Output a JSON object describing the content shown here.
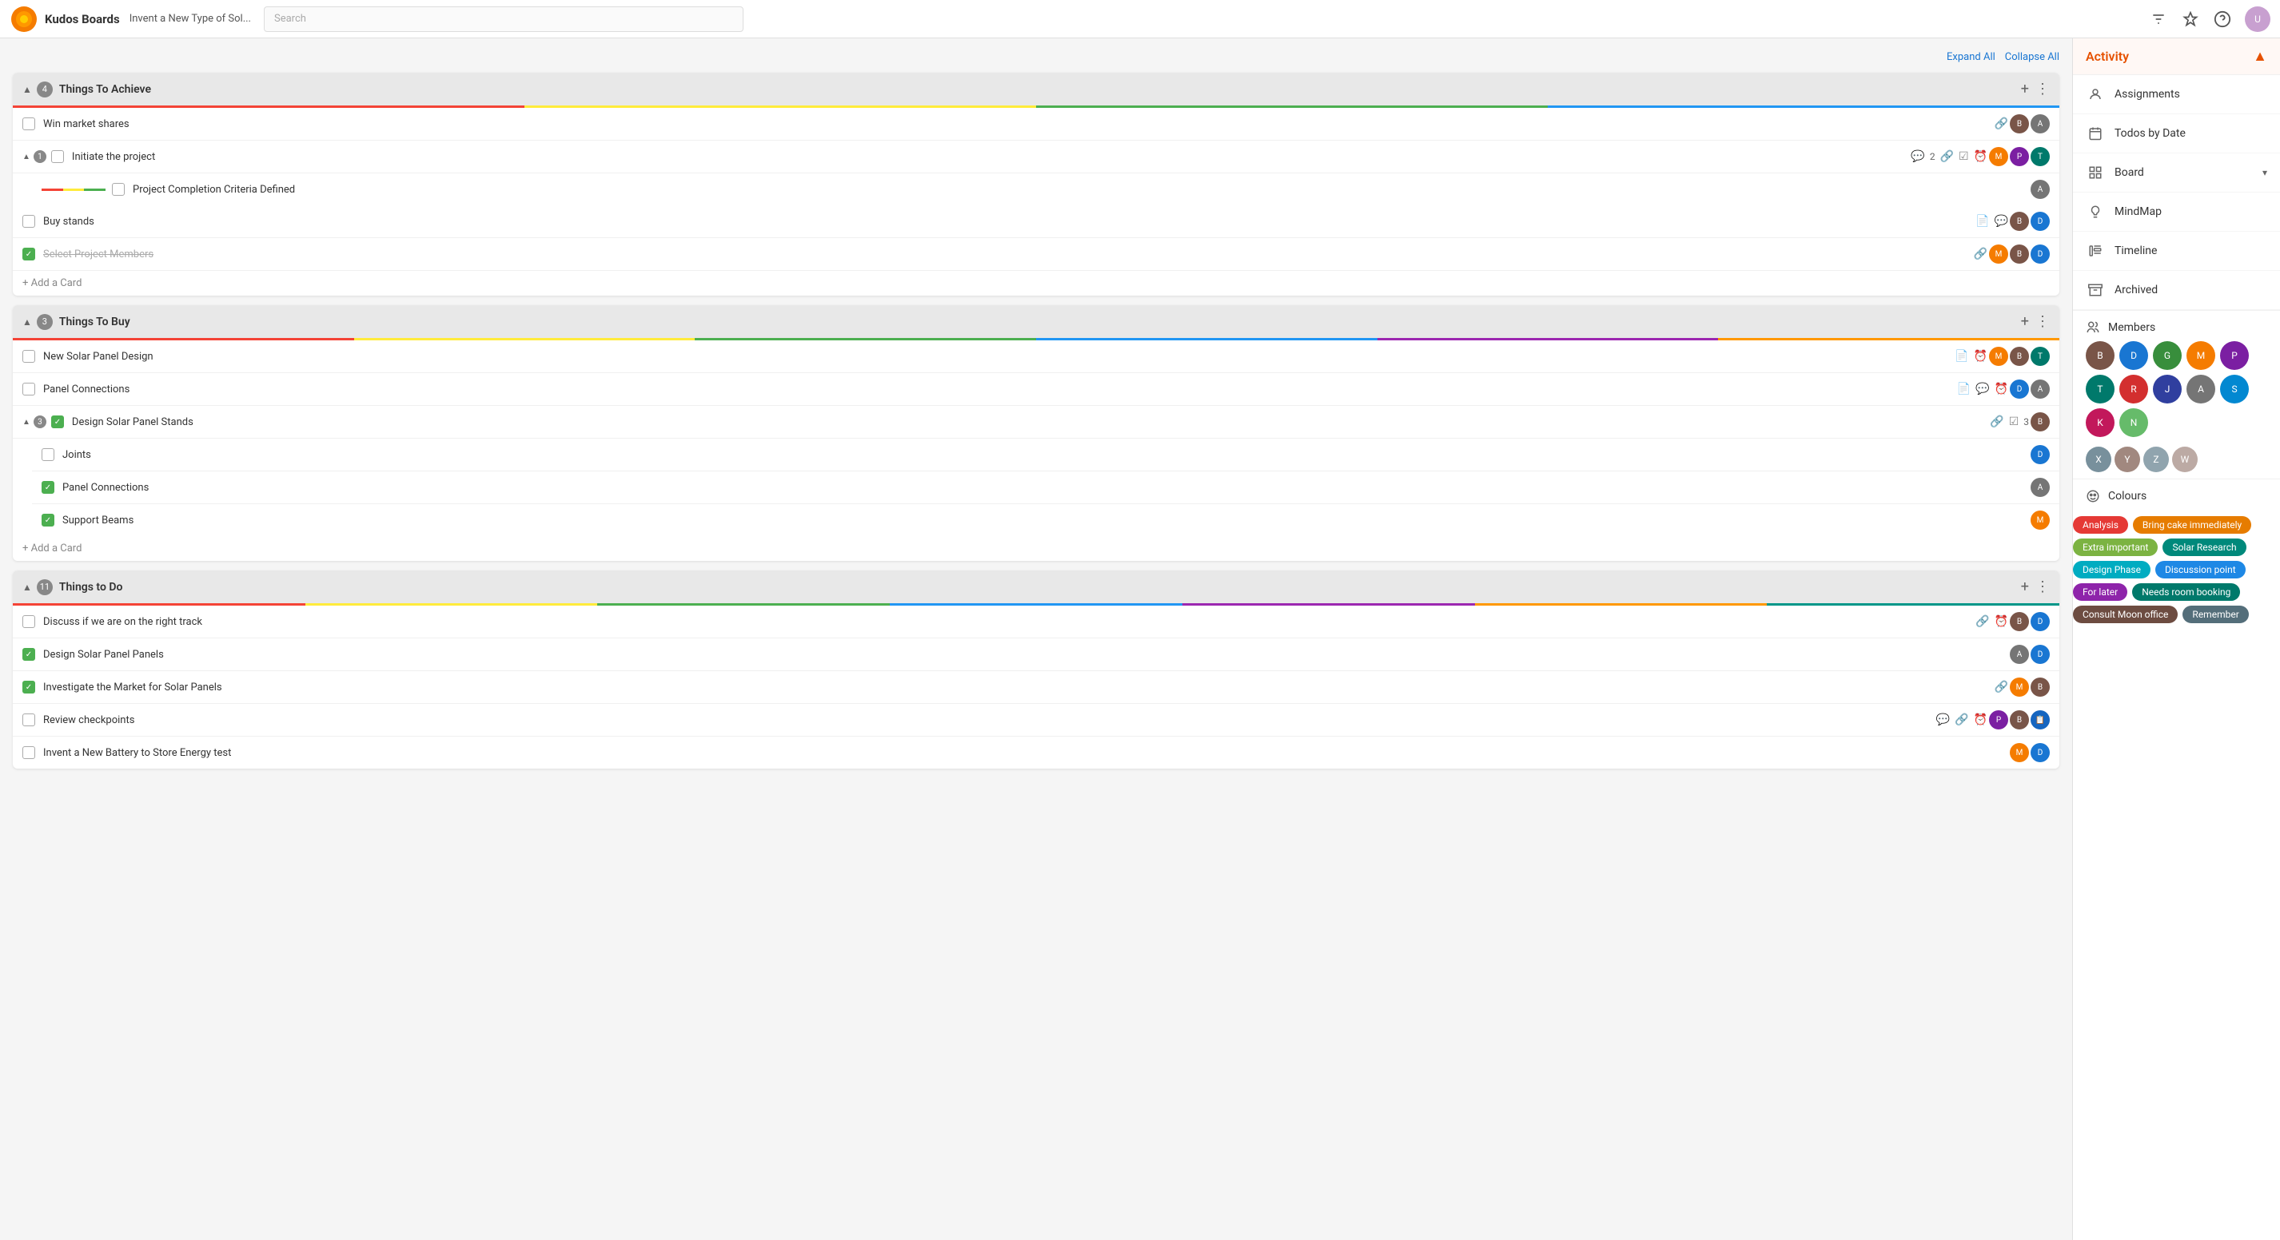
{
  "header": {
    "app_name": "Kudos Boards",
    "board_title": "Invent a New Type of Sol...",
    "search_placeholder": "Search"
  },
  "topbar": {
    "expand_all": "Expand All",
    "collapse_all": "Collapse All"
  },
  "sections": [
    {
      "id": "things-to-achieve",
      "title": "Things To Achieve",
      "count": 4,
      "color_bars": [
        "red",
        "yellow",
        "green",
        "blue"
      ],
      "cards": [
        {
          "id": "win-market-shares",
          "label": "Win market shares",
          "checked": false,
          "meta_icons": [
            "link"
          ],
          "avatars": [
            "brown",
            "gray"
          ]
        },
        {
          "id": "initiate-the-project",
          "label": "Initiate the project",
          "checked": false,
          "is_parent": true,
          "sub_count": 1,
          "meta_icons": [
            "comment",
            "link",
            "check",
            "clock"
          ],
          "meta_count": "2",
          "avatars": [
            "orange",
            "purple",
            "teal"
          ],
          "sub_items": [
            {
              "id": "project-completion",
              "label": "Project Completion Criteria Defined",
              "checked": false,
              "avatars": [
                "gray"
              ],
              "color_bars": [
                "red",
                "yellow",
                "green"
              ]
            }
          ]
        },
        {
          "id": "buy-stands",
          "label": "Buy stands",
          "checked": false,
          "meta_icons": [
            "doc",
            "comment"
          ],
          "avatars": [
            "brown",
            "blue"
          ]
        },
        {
          "id": "select-project-members",
          "label": "Select Project Members",
          "checked": true,
          "meta_icons": [
            "link"
          ],
          "avatars": [
            "orange",
            "brown",
            "blue"
          ]
        }
      ]
    },
    {
      "id": "things-to-buy",
      "title": "Things To Buy",
      "count": 3,
      "color_bars": [
        "red",
        "yellow",
        "green",
        "blue",
        "purple",
        "orange"
      ],
      "cards": [
        {
          "id": "new-solar-panel-design",
          "label": "New Solar Panel Design",
          "checked": false,
          "meta_icons": [
            "doc",
            "clock"
          ],
          "avatars": [
            "orange",
            "brown",
            "teal"
          ]
        },
        {
          "id": "panel-connections",
          "label": "Panel Connections",
          "checked": false,
          "meta_icons": [
            "doc",
            "comment",
            "clock"
          ],
          "avatars": [
            "blue",
            "gray"
          ]
        },
        {
          "id": "design-solar-panel-stands",
          "label": "Design Solar Panel Stands",
          "checked": true,
          "is_parent": true,
          "sub_count": 3,
          "meta_icons": [
            "link",
            "check"
          ],
          "meta_count": "3",
          "avatars": [
            "brown"
          ],
          "sub_items": [
            {
              "id": "joints",
              "label": "Joints",
              "checked": false,
              "avatars": [
                "blue"
              ]
            },
            {
              "id": "panel-connections-sub",
              "label": "Panel Connections",
              "checked": true,
              "avatars": [
                "gray"
              ]
            },
            {
              "id": "support-beams",
              "label": "Support Beams",
              "checked": true,
              "avatars": [
                "orange"
              ]
            }
          ]
        }
      ]
    },
    {
      "id": "things-to-do",
      "title": "Things to Do",
      "count": 11,
      "color_bars": [
        "red",
        "yellow",
        "green",
        "blue",
        "purple",
        "orange",
        "teal"
      ],
      "cards": [
        {
          "id": "discuss-track",
          "label": "Discuss if we are on the right track",
          "checked": false,
          "meta_icons": [
            "link",
            "clock"
          ],
          "avatars": [
            "brown",
            "blue"
          ]
        },
        {
          "id": "design-solar-panels",
          "label": "Design Solar Panel Panels",
          "checked": true,
          "avatars": [
            "gray",
            "blue"
          ]
        },
        {
          "id": "investigate-market",
          "label": "Investigate the Market for Solar Panels",
          "checked": true,
          "meta_icons": [
            "link"
          ],
          "avatars": [
            "orange",
            "brown"
          ]
        },
        {
          "id": "review-checkpoints",
          "label": "Review checkpoints",
          "checked": false,
          "meta_icons": [
            "comment",
            "link",
            "clock"
          ],
          "avatars": [
            "purple",
            "brown",
            "blue"
          ]
        },
        {
          "id": "invent-new-battery",
          "label": "Invent a New Battery to Store Energy test",
          "checked": false,
          "avatars": [
            "orange",
            "blue"
          ]
        }
      ]
    }
  ],
  "sidebar": {
    "activity_label": "Activity",
    "items": [
      {
        "id": "assignments",
        "label": "Assignments",
        "icon": "person"
      },
      {
        "id": "todos-by-date",
        "label": "Todos by Date",
        "icon": "calendar"
      },
      {
        "id": "board",
        "label": "Board",
        "icon": "grid",
        "has_arrow": true
      },
      {
        "id": "mindmap",
        "label": "MindMap",
        "icon": "bulb"
      },
      {
        "id": "timeline",
        "label": "Timeline",
        "icon": "timeline"
      },
      {
        "id": "archived",
        "label": "Archived",
        "icon": "archive"
      }
    ],
    "members_label": "Members",
    "members": [
      {
        "color": "av-brown",
        "initials": "B"
      },
      {
        "color": "av-blue",
        "initials": "D"
      },
      {
        "color": "av-green",
        "initials": "G"
      },
      {
        "color": "av-orange",
        "initials": "M"
      },
      {
        "color": "av-purple",
        "initials": "P"
      },
      {
        "color": "av-teal",
        "initials": "T"
      },
      {
        "color": "av-red",
        "initials": "R"
      },
      {
        "color": "av-pink",
        "initials": "K"
      },
      {
        "color": "av-gray",
        "initials": "A"
      },
      {
        "color": "av-indigo",
        "initials": "J"
      },
      {
        "color": "av-lightblue",
        "initials": "S"
      },
      {
        "color": "av-green",
        "initials": "N"
      }
    ],
    "colours_label": "Colours",
    "colour_chips": [
      {
        "label": "Analysis",
        "bg": "#e53935"
      },
      {
        "label": "Bring cake immediately",
        "bg": "#e67c00"
      },
      {
        "label": "Extra important",
        "bg": "#7cb342"
      },
      {
        "label": "Solar Research",
        "bg": "#00897b"
      },
      {
        "label": "Design Phase",
        "bg": "#00acc1"
      },
      {
        "label": "Discussion point",
        "bg": "#1e88e5"
      },
      {
        "label": "For later",
        "bg": "#8e24aa"
      },
      {
        "label": "Needs room booking",
        "bg": "#00796b"
      },
      {
        "label": "Consult Moon office",
        "bg": "#6d4c41"
      },
      {
        "label": "Remember",
        "bg": "#546e7a"
      }
    ]
  }
}
